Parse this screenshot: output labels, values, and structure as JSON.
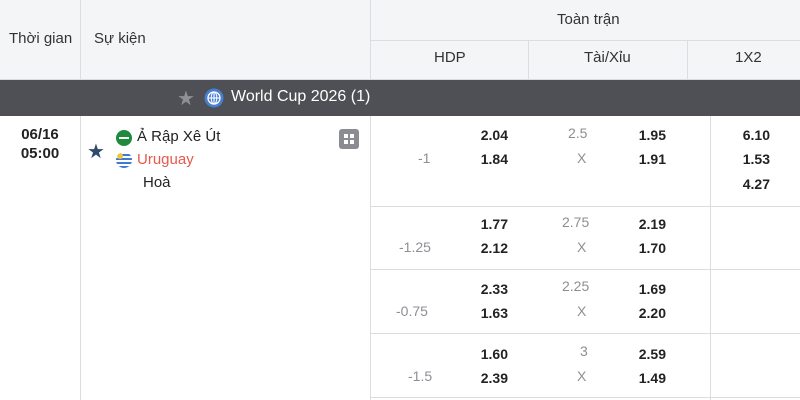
{
  "header": {
    "time_label": "Thời gian",
    "event_label": "Sự kiện",
    "full_match_label": "Toàn trận",
    "hdp_label": "HDP",
    "ou_label": "Tài/Xỉu",
    "x12_label": "1X2"
  },
  "league": {
    "name": "World Cup 2026 (1)"
  },
  "match": {
    "date": "06/16",
    "time": "05:00",
    "home": "Ả Rập Xê Út",
    "away": "Uruguay",
    "draw": "Hoà"
  },
  "odds_rows": [
    {
      "hdp_line": "-1",
      "hdp_home": "2.04",
      "hdp_away": "1.84",
      "ou_line": "2.5",
      "ou_x": "X",
      "ou_over": "1.95",
      "ou_under": "1.91",
      "x12_home": "6.10",
      "x12_away": "1.53",
      "x12_draw": "4.27"
    },
    {
      "hdp_line": "-1.25",
      "hdp_home": "1.77",
      "hdp_away": "2.12",
      "ou_line": "2.75",
      "ou_x": "X",
      "ou_over": "2.19",
      "ou_under": "1.70"
    },
    {
      "hdp_line": "-0.75",
      "hdp_home": "2.33",
      "hdp_away": "1.63",
      "ou_line": "2.25",
      "ou_x": "X",
      "ou_over": "1.69",
      "ou_under": "2.20"
    },
    {
      "hdp_line": "-1.5",
      "hdp_home": "1.60",
      "hdp_away": "2.39",
      "ou_line": "3",
      "ou_x": "X",
      "ou_over": "2.59",
      "ou_under": "1.49"
    }
  ],
  "colors": {
    "away_team": "#e8584b",
    "league_bar": "#4e5055",
    "favorite_star": "#2f4a6d"
  },
  "icons": {
    "favorite": "star-icon",
    "league": "globe-icon",
    "stats": "stats-icon"
  }
}
